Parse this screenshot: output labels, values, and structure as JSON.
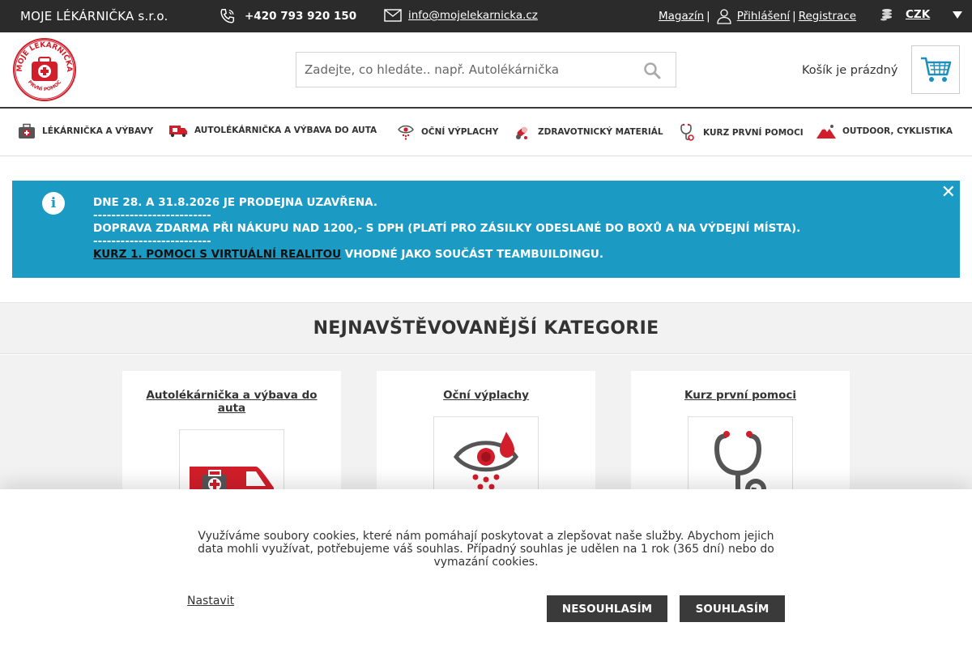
{
  "topbar": {
    "brand": "MOJE LÉKÁRNIČKA s.r.o.",
    "phone": "+420 793 920 150",
    "email": "info@mojelekarnicka.cz",
    "magazine": "Magazín",
    "login": "Přihlášení",
    "register": "Registrace",
    "currency": "CZK"
  },
  "header": {
    "logo_text_top": "MOJE LÉKÁRNIČKA",
    "logo_text_bottom": "PRVNÍ POMOC",
    "search_placeholder": "Zadejte, co hledáte.. např. Autolékárnička",
    "cart_status": "Košík je prázdný"
  },
  "nav": {
    "items": [
      {
        "label": "Lékárnička a výbavy",
        "icon": "first-aid-kit-icon"
      },
      {
        "label": "Autolékárnička a výbava do auta",
        "icon": "ambulance-icon"
      },
      {
        "label": "Oční výplachy",
        "icon": "eye-wash-icon"
      },
      {
        "label": "Zdravotnický materiál",
        "icon": "pills-icon"
      },
      {
        "label": "Kurz první pomoci",
        "icon": "stethoscope-icon"
      },
      {
        "label": "Outdoor, cyklistika",
        "icon": "mountain-icon"
      }
    ]
  },
  "alert": {
    "line1": "DNE 28. A 31.8.2026 JE PRODEJNA UZAVŘENA.",
    "divider": "--------------------------",
    "line2": "DOPRAVA ZDARMA PŘI NÁKUPU NAD 1200,- S DPH (PLATÍ PRO ZÁSILKY ODESLANÉ DO BOXŮ A NA VÝDEJNÍ MÍSTA).",
    "line3_link": "KURZ 1. POMOCI S VIRTUÁLNÍ REALITOU",
    "line3_rest": " VHODNÉ JAKO SOUČÁST TEAMBUILDINGU."
  },
  "categories": {
    "title": "NEJNAVŠTĚVOVANĚJŠÍ KATEGORIE",
    "cards": [
      {
        "title": "Autolékárnička a výbava do auta",
        "icon": "ambulance-icon"
      },
      {
        "title": "Oční výplachy",
        "icon": "eye-wash-icon"
      },
      {
        "title": "Kurz první pomoci",
        "icon": "stethoscope-icon"
      }
    ]
  },
  "cookie": {
    "message": "Využíváme soubory cookies, které nám pomáhají poskytovat a zlepšovat naše služby. Abychom jejich data mohli využívat, potřebujeme váš souhlas. Případný souhlas je udělen na 1 rok (365 dní) nebo do vymazání cookies.",
    "settings": "Nastavit",
    "disagree": "NESOUHLASÍM",
    "agree": "SOUHLASÍM"
  },
  "colors": {
    "topbar": "#2b2b2b",
    "accent_red": "#d11e2a",
    "alert_blue": "#1b9bc4",
    "button_dark": "#3a3a3a"
  }
}
